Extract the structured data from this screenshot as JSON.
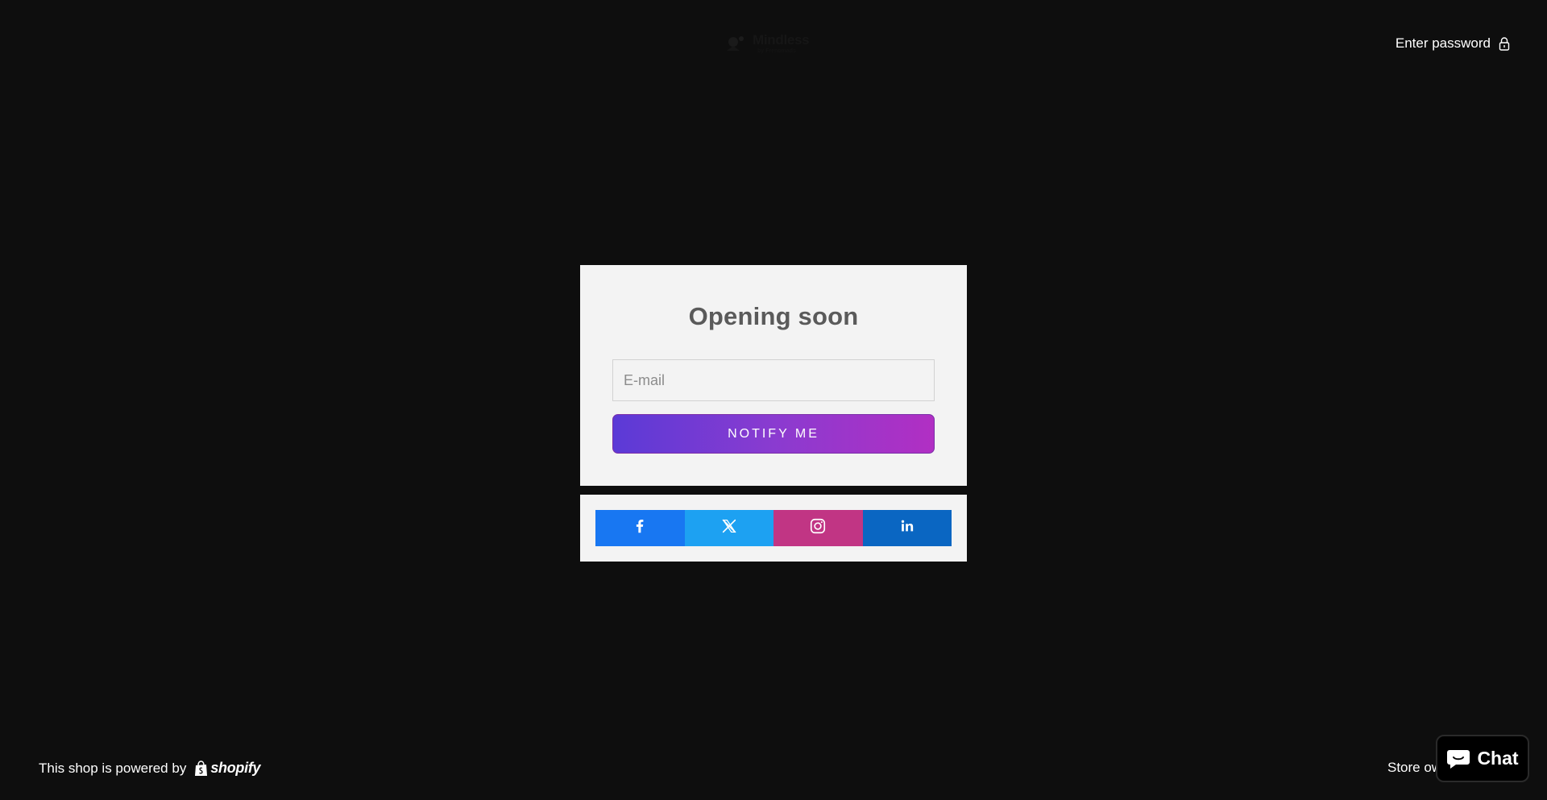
{
  "header": {
    "logo_name": "Mindless",
    "logo_sub": "by Frenomads",
    "logo_icon": "logo-mark-icon",
    "enter_password_label": "Enter password",
    "lock_icon": "lock-icon"
  },
  "signup": {
    "title": "Opening soon",
    "email_placeholder": "E-mail",
    "email_value": "",
    "notify_label": "NOTIFY ME",
    "notify_gradient": [
      "#5b3ad6",
      "#b12fc3"
    ]
  },
  "social": {
    "buttons": [
      {
        "name": "facebook",
        "icon": "facebook-icon",
        "color": "#1877f2"
      },
      {
        "name": "x",
        "icon": "x-icon",
        "color": "#1da1f2"
      },
      {
        "name": "instagram",
        "icon": "instagram-icon",
        "color": "#c13584"
      },
      {
        "name": "linkedin",
        "icon": "linkedin-icon",
        "color": "#0a66c2"
      }
    ]
  },
  "footer": {
    "powered_by_text": "This shop is powered by",
    "shopify_label": "shopify",
    "shopify_icon": "shopify-bag-icon",
    "store_owner_label": "Store owner login"
  },
  "chat": {
    "label": "Chat",
    "icon": "chat-bubble-icon"
  },
  "colors": {
    "background": "#0e0e0e",
    "card_background": "#f3f3f3",
    "title_text": "#5a5a5a"
  }
}
